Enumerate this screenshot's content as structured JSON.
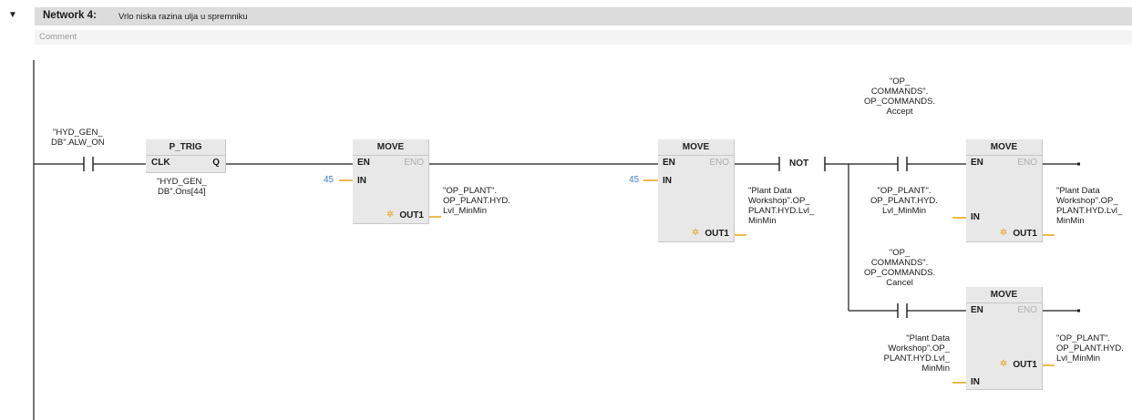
{
  "network": {
    "toggle": "▼",
    "title": "Network 4:",
    "description": "Vrlo niska razina ulja u spremniku",
    "comment_placeholder": "Comment"
  },
  "contacts": {
    "alw_on": [
      "\"HYD_GEN_",
      "DB\".ALW_ON"
    ],
    "accept": [
      "\"OP_",
      "COMMANDS\".",
      "OP_COMMANDS.",
      "Accept"
    ],
    "cancel": [
      "\"OP_",
      "COMMANDS\".",
      "OP_COMMANDS.",
      "Cancel"
    ]
  },
  "ptrig": {
    "title": "P_TRIG",
    "clk": "CLK",
    "q": "Q",
    "operand": [
      "\"HYD_GEN_",
      "DB\".Ons[44]"
    ]
  },
  "not_label": "NOT",
  "move_blocks": [
    {
      "title": "MOVE",
      "en": "EN",
      "eno": "ENO",
      "in_pin": "IN",
      "out_pin": "OUT1",
      "in_value": "45",
      "out_value": [
        "\"OP_PLANT\".",
        "OP_PLANT.HYD.",
        "Lvl_MinMin"
      ]
    },
    {
      "title": "MOVE",
      "en": "EN",
      "eno": "ENO",
      "in_pin": "IN",
      "out_pin": "OUT1",
      "in_value": "45",
      "out_value": [
        "\"Plant Data",
        "Workshop\".OP_",
        "PLANT.HYD.Lvl_",
        "MinMin"
      ]
    },
    {
      "title": "MOVE",
      "en": "EN",
      "eno": "ENO",
      "in_pin": "IN",
      "out_pin": "OUT1",
      "in_value": [
        "\"OP_PLANT\".",
        "OP_PLANT.HYD.",
        "Lvl_MinMin"
      ],
      "out_value": [
        "\"Plant Data",
        "Workshop\".OP_",
        "PLANT.HYD.Lvl_",
        "MinMin"
      ]
    },
    {
      "title": "MOVE",
      "en": "EN",
      "eno": "ENO",
      "in_pin": "IN",
      "out_pin": "OUT1",
      "in_value": [
        "\"Plant Data",
        "Workshop\".OP_",
        "PLANT.HYD.Lvl_",
        "MinMin"
      ],
      "out_value": [
        "\"OP_PLANT\".",
        "OP_PLANT.HYD.",
        "Lvl_MinMin"
      ]
    }
  ],
  "colors": {
    "wire": "#1a1a1a",
    "value_wire": "#e8a317",
    "constant": "#3a7bd5",
    "box_fill": "#e8e8e8",
    "header_bar": "#dcdcdc"
  }
}
